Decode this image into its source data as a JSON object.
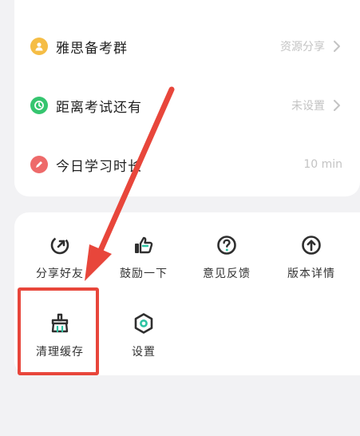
{
  "info_rows": [
    {
      "label": "雅思备考群",
      "value": "资源分享",
      "icon": "group-icon",
      "color": "#f5bd45"
    },
    {
      "label": "距离考试还有",
      "value": "未设置",
      "icon": "clock-icon",
      "color": "#35c56f"
    },
    {
      "label": "今日学习时长",
      "value": "10 min",
      "icon": "pencil-icon",
      "color": "#ee6a6a"
    }
  ],
  "tools": [
    {
      "label": "分享好友",
      "icon": "share-icon"
    },
    {
      "label": "鼓励一下",
      "icon": "thumbs-up-icon"
    },
    {
      "label": "意见反馈",
      "icon": "question-icon"
    },
    {
      "label": "版本详情",
      "icon": "upgrade-arrow-icon"
    },
    {
      "label": "清理缓存",
      "icon": "broom-icon"
    },
    {
      "label": "设置",
      "icon": "settings-hexagon-icon"
    }
  ],
  "annotation": {
    "color": "#e8463b"
  }
}
